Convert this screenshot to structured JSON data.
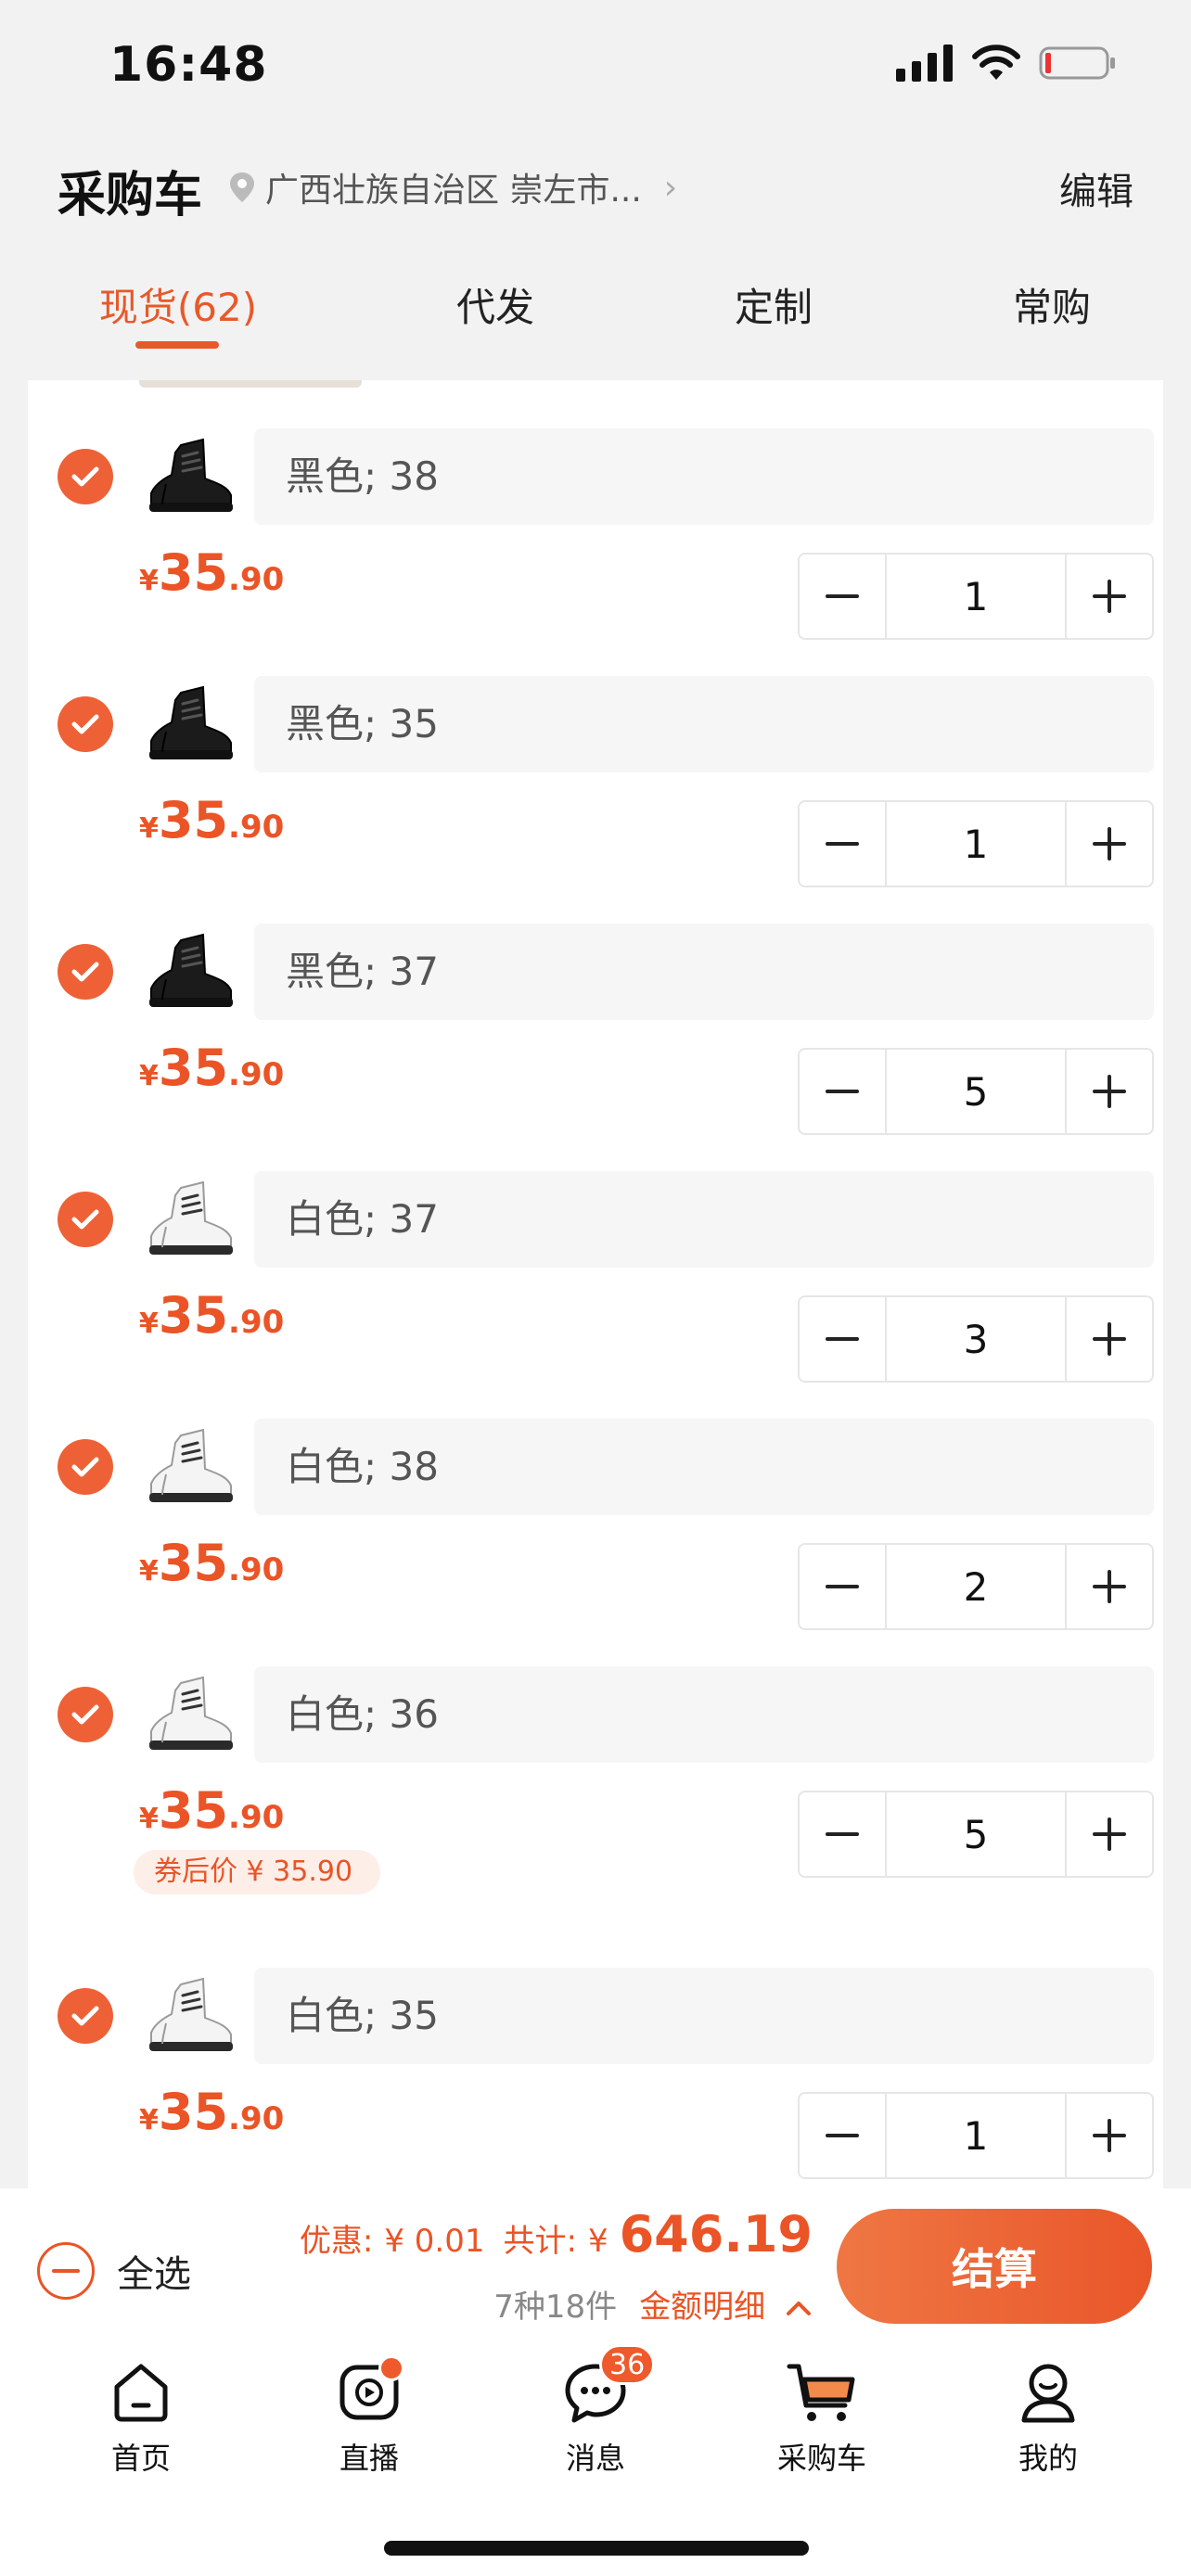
{
  "status_bar": {
    "time": "16:48"
  },
  "header": {
    "title": "采购车",
    "location": "广西壮族自治区 崇左市...",
    "edit_label": "编辑"
  },
  "tabs": [
    {
      "label": "现货(62)",
      "active": true
    },
    {
      "label": "代发",
      "active": false
    },
    {
      "label": "定制",
      "active": false
    },
    {
      "label": "常购",
      "active": false
    }
  ],
  "items": [
    {
      "spec": "黑色; 38",
      "shoe_color": "black",
      "price_currency": "¥",
      "price_int": "35",
      "price_dec": ".90",
      "quantity": "1",
      "checked": true,
      "coupon": ""
    },
    {
      "spec": "黑色; 35",
      "shoe_color": "black",
      "price_currency": "¥",
      "price_int": "35",
      "price_dec": ".90",
      "quantity": "1",
      "checked": true,
      "coupon": ""
    },
    {
      "spec": "黑色; 37",
      "shoe_color": "black",
      "price_currency": "¥",
      "price_int": "35",
      "price_dec": ".90",
      "quantity": "5",
      "checked": true,
      "coupon": ""
    },
    {
      "spec": "白色; 37",
      "shoe_color": "white",
      "price_currency": "¥",
      "price_int": "35",
      "price_dec": ".90",
      "quantity": "3",
      "checked": true,
      "coupon": ""
    },
    {
      "spec": "白色; 38",
      "shoe_color": "white",
      "price_currency": "¥",
      "price_int": "35",
      "price_dec": ".90",
      "quantity": "2",
      "checked": true,
      "coupon": ""
    },
    {
      "spec": "白色; 36",
      "shoe_color": "white",
      "price_currency": "¥",
      "price_int": "35",
      "price_dec": ".90",
      "quantity": "5",
      "checked": true,
      "coupon": "券后价 ¥ 35.90"
    },
    {
      "spec": "白色; 35",
      "shoe_color": "white",
      "price_currency": "¥",
      "price_int": "35",
      "price_dec": ".90",
      "quantity": "1",
      "checked": true,
      "coupon": ""
    }
  ],
  "footer": {
    "select_all_label": "全选",
    "discount_label": "优惠:",
    "discount_value": "¥ 0.01",
    "total_label": "共计:",
    "total_currency": "¥",
    "total_value": "646.19",
    "kinds_count": "7种18件",
    "details_label": "金额明细",
    "checkout_label": "结算"
  },
  "tabbar": [
    {
      "label": "首页",
      "icon": "home-icon"
    },
    {
      "label": "直播",
      "icon": "live-icon",
      "dot": true
    },
    {
      "label": "消息",
      "icon": "message-icon",
      "badge": "36"
    },
    {
      "label": "采购车",
      "icon": "cart-icon",
      "active": true
    },
    {
      "label": "我的",
      "icon": "profile-icon"
    }
  ],
  "colors": {
    "accent": "#EA5426",
    "check": "#EE6136",
    "spec_bg": "#F6F6F6",
    "page_bg": "#F2F2F2"
  }
}
